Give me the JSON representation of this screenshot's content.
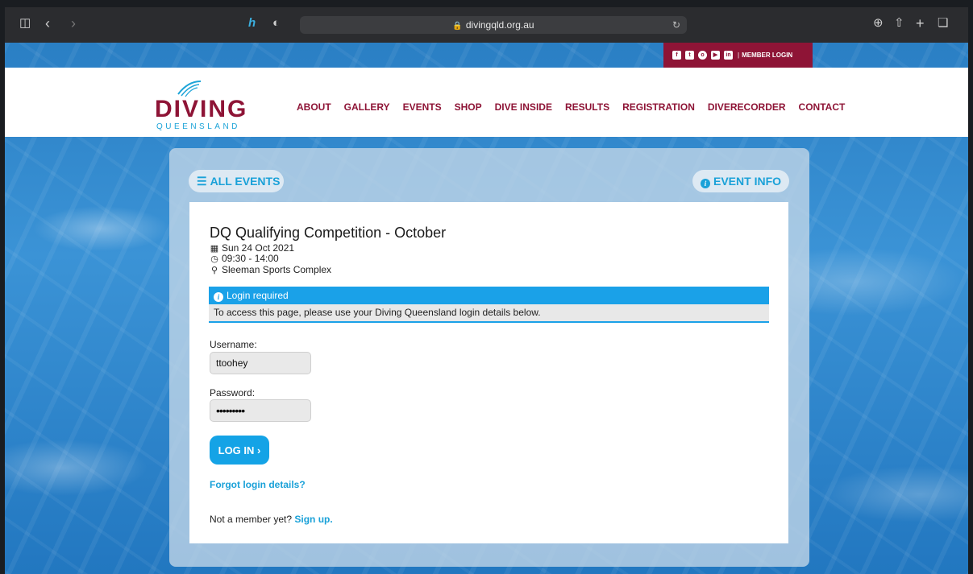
{
  "browser": {
    "url": "divingqld.org.au",
    "icons": [
      "sidebar-icon",
      "back-icon",
      "forward-icon",
      "extension-icon",
      "privacy-shield-icon",
      "reload-icon",
      "download-icon",
      "share-icon",
      "new-tab-icon",
      "tabs-icon"
    ]
  },
  "social": {
    "icons": [
      "facebook-icon",
      "twitter-icon",
      "instagram-icon",
      "youtube-icon",
      "linkedin-icon"
    ],
    "separator": "|",
    "member_login": "MEMBER LOGIN"
  },
  "logo": {
    "word": "DIVING",
    "sub": "QUEENSLAND"
  },
  "nav": {
    "items": [
      "ABOUT",
      "GALLERY",
      "EVENTS",
      "SHOP",
      "DIVE INSIDE",
      "RESULTS",
      "REGISTRATION",
      "DIVERECORDER",
      "CONTACT"
    ]
  },
  "panel": {
    "all_events": "ALL EVENTS",
    "event_info": "EVENT INFO"
  },
  "event": {
    "title": "DQ Qualifying Competition - October",
    "date": "Sun 24 Oct 2021",
    "time": "09:30 - 14:00",
    "venue": "Sleeman Sports Complex"
  },
  "alert": {
    "heading": "Login required",
    "message": "To access this page, please use your Diving Queensland login details below."
  },
  "form": {
    "username_label": "Username:",
    "username_value": "ttoohey",
    "password_label": "Password:",
    "password_value": "•••••••••",
    "login_button": "LOG IN",
    "forgot_link": "Forgot login details?",
    "not_member": "Not a member yet?",
    "signup_link": "Sign up."
  },
  "colors": {
    "brand": "#8e1436",
    "accent": "#1aa1d8",
    "alert": "#1aa1e8"
  }
}
